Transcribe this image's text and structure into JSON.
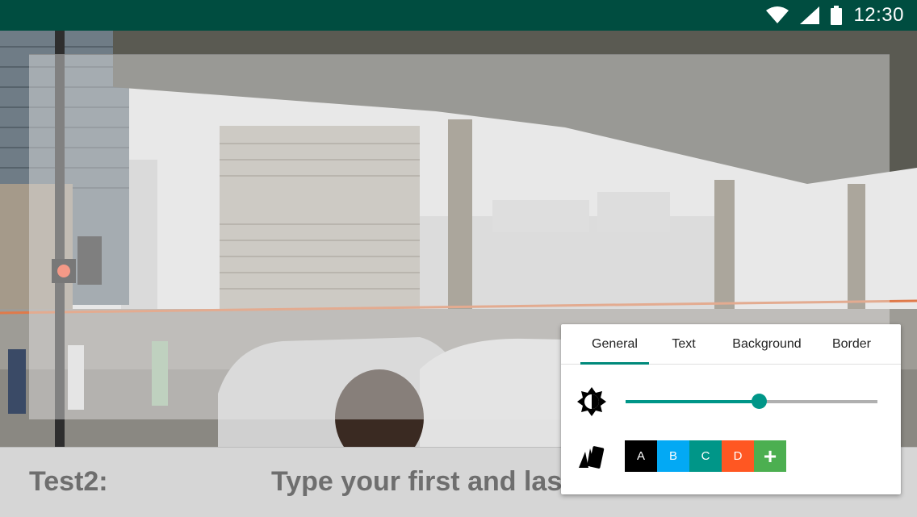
{
  "status_bar": {
    "time": "12:30",
    "icons": [
      "wifi-icon",
      "cellular-signal-icon",
      "battery-icon"
    ],
    "background": "#004d40"
  },
  "caption": {
    "label": "Test2:",
    "input_text": "Type your first and last name"
  },
  "panel": {
    "tabs": [
      {
        "label": "General",
        "active": true
      },
      {
        "label": "Text",
        "active": false
      },
      {
        "label": "Background",
        "active": false
      },
      {
        "label": "Border",
        "active": false
      }
    ],
    "brightness": {
      "icon": "brightness-icon",
      "value_percent": 53
    },
    "palette": {
      "icon": "color-cards-icon",
      "swatches": [
        {
          "label": "A",
          "color": "#000000"
        },
        {
          "label": "B",
          "color": "#03a9f4"
        },
        {
          "label": "C",
          "color": "#009688"
        },
        {
          "label": "D",
          "color": "#ff5722"
        },
        {
          "label": "+",
          "color": "#4caf50"
        }
      ]
    },
    "accent": "#009688"
  }
}
